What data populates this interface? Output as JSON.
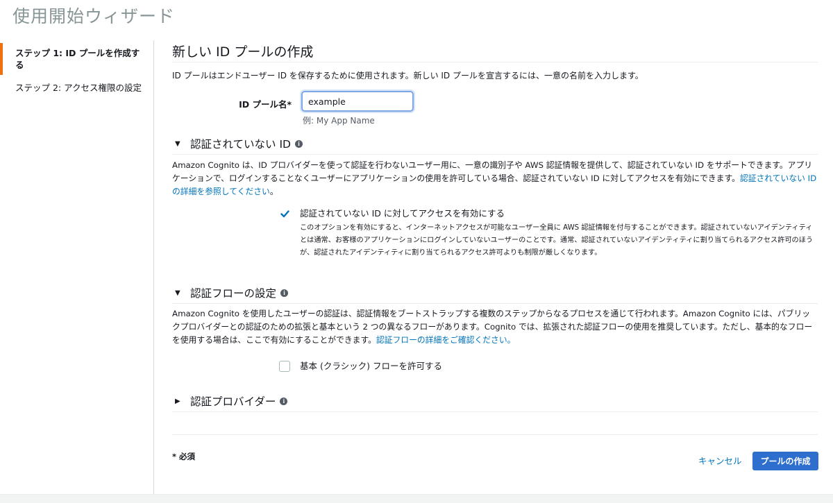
{
  "page": {
    "title": "使用開始ウィザード"
  },
  "sidebar": {
    "steps": [
      {
        "label": "ステップ 1: ID プールを作成する",
        "active": true
      },
      {
        "label": "ステップ 2: アクセス権限の設定",
        "active": false
      }
    ]
  },
  "main": {
    "heading": "新しい ID プールの作成",
    "intro": "ID プールはエンドユーザー ID を保存するために使用されます。新しい ID プールを宣言するには、一意の名前を入力します。",
    "pool_name": {
      "label": "ID プール名*",
      "value": "example",
      "hint": "例: My App Name"
    },
    "unauth_section": {
      "title": "認証されていない ID",
      "description": "Amazon Cognito は、ID プロバイダーを使って認証を行わないユーザー用に、一意の識別子や AWS 認証情報を提供して、認証されていない ID をサポートできます。アプリケーションで、ログインすることなくユーザーにアプリケーションの使用を許可している場合、認証されていない ID に対してアクセスを有効にできます。",
      "link": "認証されていない ID の詳細を参照してください",
      "period": "。",
      "checkbox_label": "認証されていない ID に対してアクセスを有効にする",
      "checkbox_checked": true,
      "checkbox_desc": "このオプションを有効にすると、インターネットアクセスが可能なユーザー全員に AWS 認証情報を付与することができます。認証されていないアイデンティティとは通常、お客様のアプリケーションにログインしていないユーザーのことです。通常、認証されていないアイデンティティに割り当てられるアクセス許可のほうが、認証されたアイデンティティに割り当てられるアクセス許可よりも制限が厳しくなります。"
    },
    "flow_section": {
      "title": "認証フローの設定",
      "description": "Amazon Cognito を使用したユーザーの認証は、認証情報をブートストラップする複数のステップからなるプロセスを通じて行われます。Amazon Cognito には、パブリックプロバイダーとの認証のための拡張と基本という 2 つの異なるフローがあります。Cognito では、拡張された認証フローの使用を推奨しています。ただし、基本的なフローを使用する場合は、ここで有効にすることができます。",
      "link": "認証フローの詳細をご確認ください。",
      "checkbox_label": "基本 (クラシック) フローを許可する",
      "checkbox_checked": false
    },
    "provider_section": {
      "title": "認証プロバイダー"
    }
  },
  "footer": {
    "required_note": "* 必須",
    "cancel_label": "キャンセル",
    "create_label": "プールの作成"
  },
  "colors": {
    "accent": "#ec7211",
    "link": "#0073bb",
    "primary_button": "#2e6fce",
    "checkbox": "#0073bb"
  }
}
